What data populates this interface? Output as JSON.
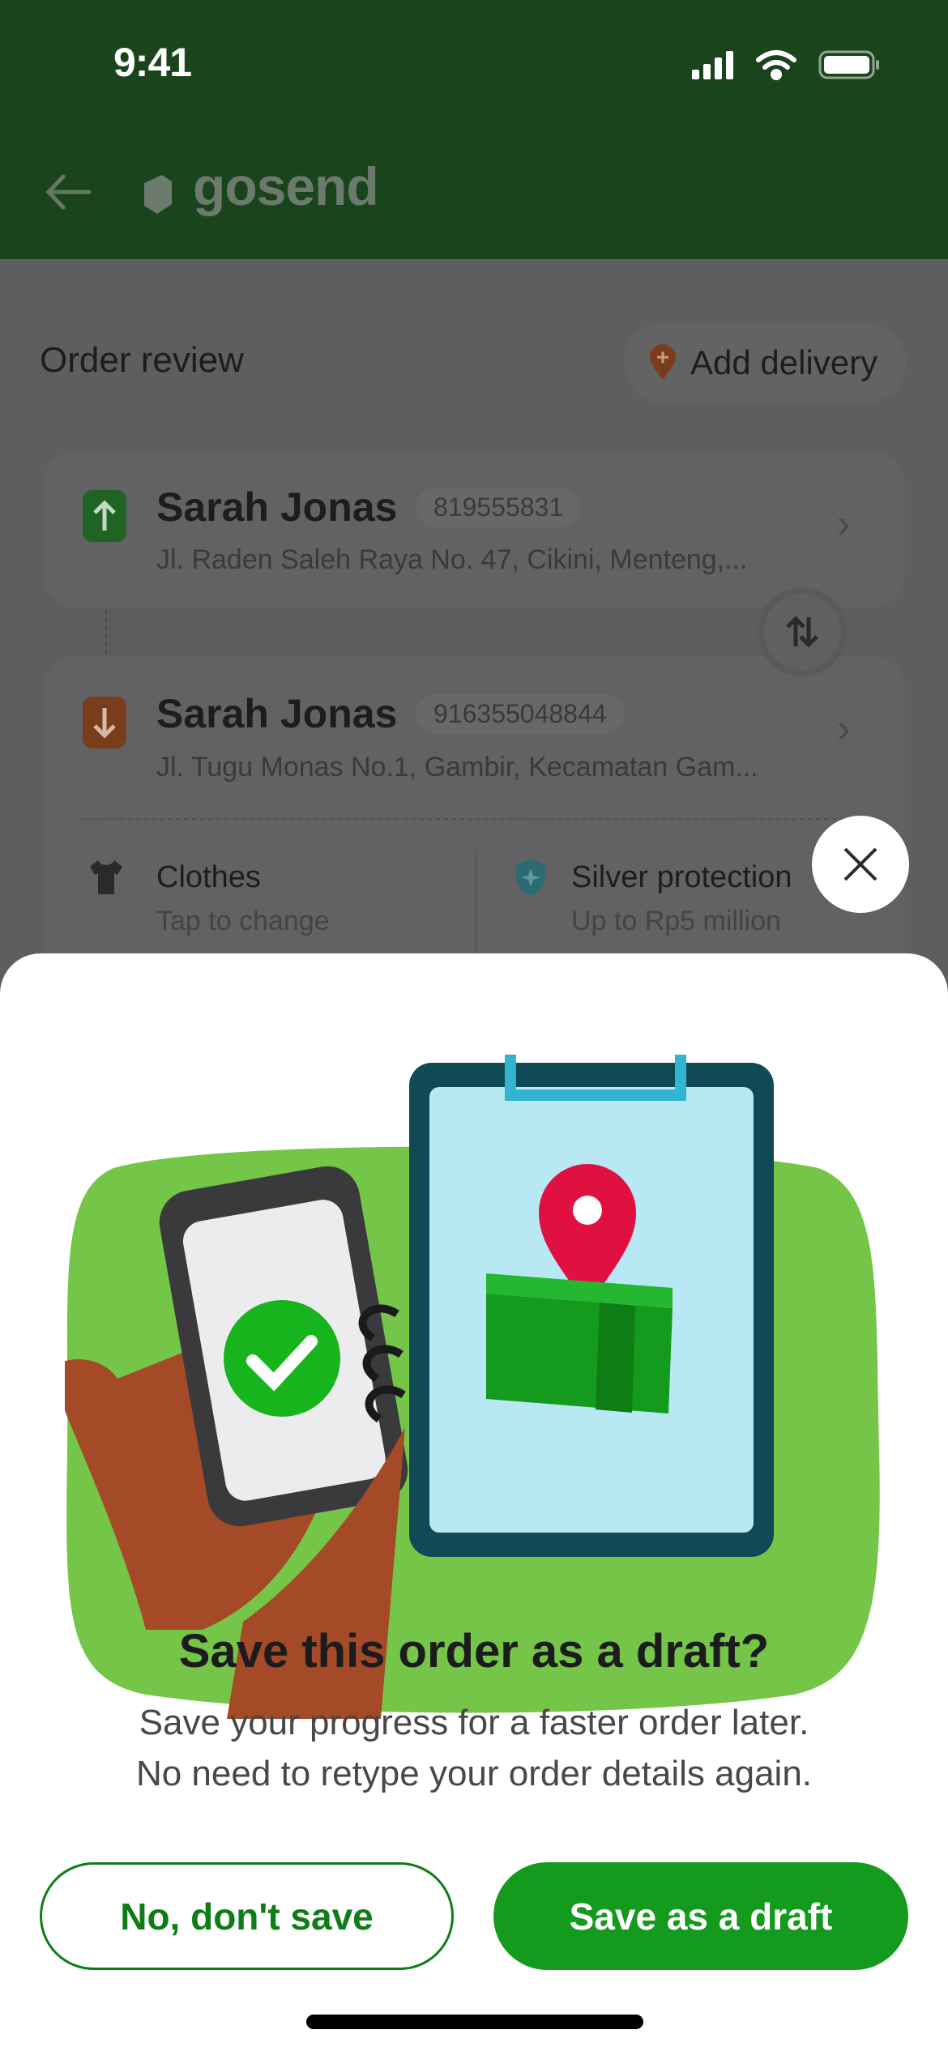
{
  "status_bar": {
    "time": "9:41"
  },
  "header": {
    "brand": "gosend"
  },
  "order": {
    "title": "Order review",
    "add_delivery": "Add delivery",
    "sender": {
      "name": "Sarah Jonas",
      "phone": "819555831",
      "address": "Jl. Raden Saleh Raya No. 47, Cikini, Menteng,..."
    },
    "recipient": {
      "name": "Sarah Jonas",
      "phone": "916355048844",
      "address": "Jl. Tugu Monas No.1, Gambir, Kecamatan Gam..."
    },
    "item": {
      "label": "Clothes",
      "hint": "Tap to change"
    },
    "protection": {
      "label": "Silver protection",
      "hint": "Up to Rp5 million"
    }
  },
  "dialog": {
    "title": "Save this order as a draft?",
    "line1": "Save your progress for a faster order later.",
    "line2": "No need to retype your order details again.",
    "secondary": "No, don't save",
    "primary": "Save as a draft"
  },
  "colors": {
    "header": "#1a451c",
    "primary": "#149a1c",
    "secondary_text": "#0f7d17"
  }
}
